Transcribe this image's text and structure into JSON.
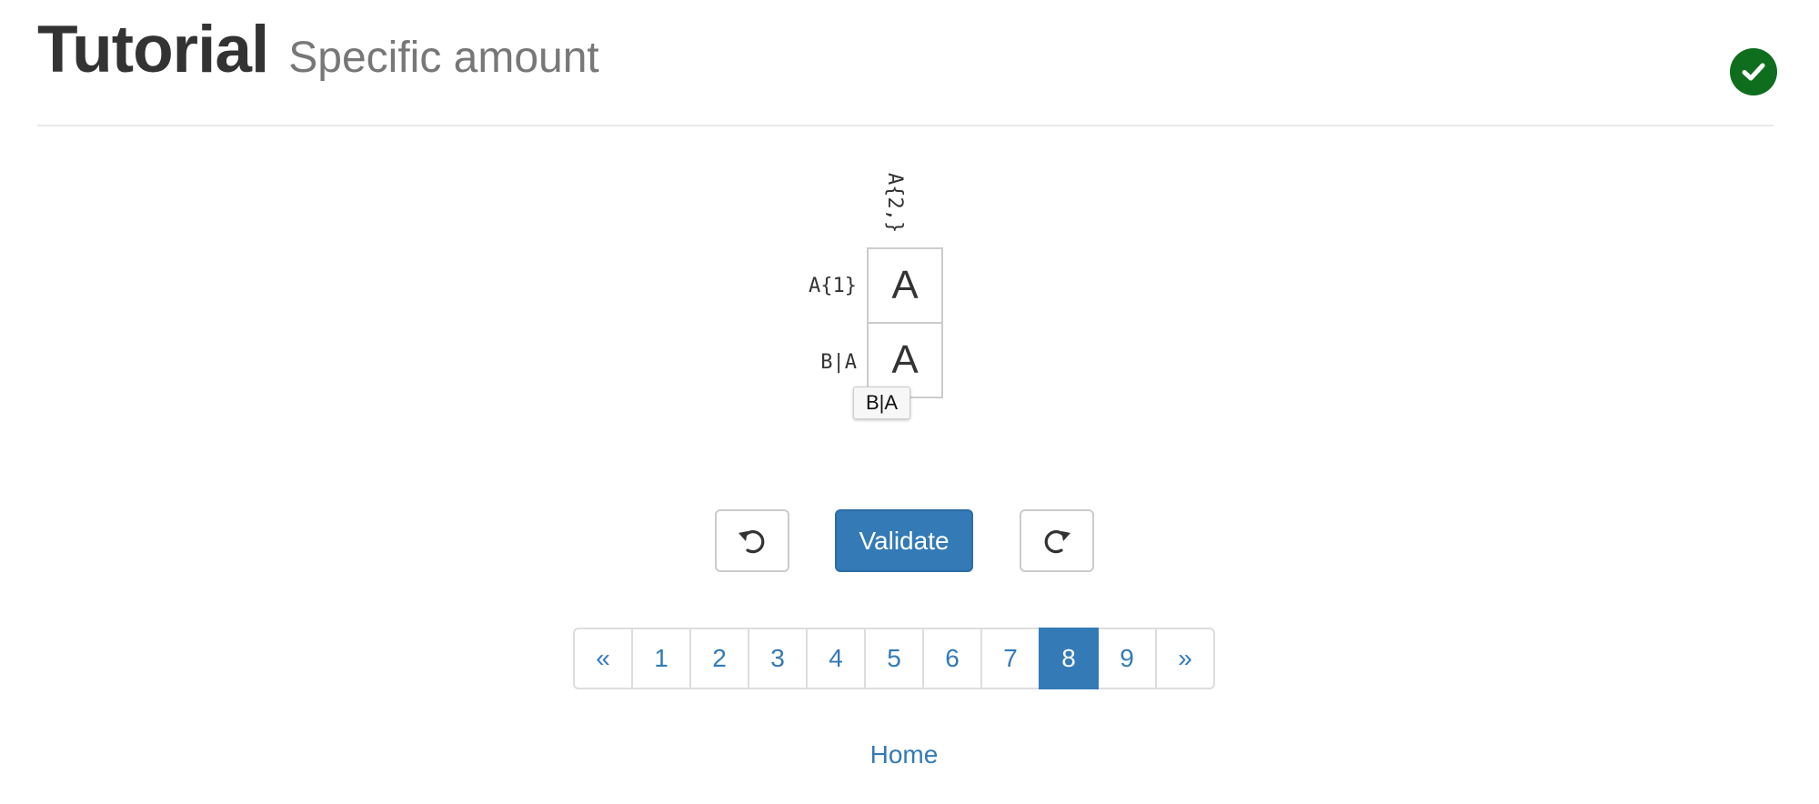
{
  "header": {
    "title": "Tutorial",
    "subtitle": "Specific amount",
    "status_icon": "check-circle-icon",
    "status_color": "#0f6e1e"
  },
  "puzzle": {
    "column_clues": [
      "A{2,}"
    ],
    "row_clues": [
      "A{1}",
      "B|A"
    ],
    "cells": [
      "A",
      "A"
    ],
    "tooltip": "B|A"
  },
  "controls": {
    "undo_icon": "undo-icon",
    "validate_label": "Validate",
    "redo_icon": "redo-icon",
    "accent_color": "#337ab7"
  },
  "pagination": {
    "prev_label": "«",
    "pages": [
      "1",
      "2",
      "3",
      "4",
      "5",
      "6",
      "7",
      "8",
      "9"
    ],
    "current": "8",
    "next_label": "»"
  },
  "footer": {
    "home_label": "Home"
  }
}
